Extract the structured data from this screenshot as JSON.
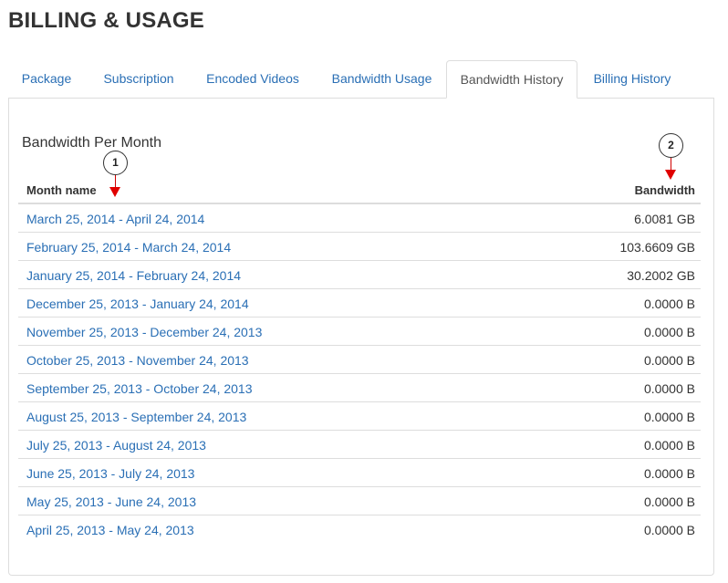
{
  "page": {
    "title": "BILLING & USAGE"
  },
  "tabs": [
    {
      "label": "Package"
    },
    {
      "label": "Subscription"
    },
    {
      "label": "Encoded Videos"
    },
    {
      "label": "Bandwidth Usage"
    },
    {
      "label": "Bandwidth History",
      "active": true
    },
    {
      "label": "Billing History"
    }
  ],
  "section": {
    "title": "Bandwidth Per Month"
  },
  "table": {
    "headers": {
      "month": "Month name",
      "bandwidth": "Bandwidth"
    },
    "rows": [
      {
        "month": "March 25, 2014 - April 24, 2014",
        "bandwidth": "6.0081 GB"
      },
      {
        "month": "February 25, 2014 - March 24, 2014",
        "bandwidth": "103.6609 GB"
      },
      {
        "month": "January 25, 2014 - February 24, 2014",
        "bandwidth": "30.2002 GB"
      },
      {
        "month": "December 25, 2013 - January 24, 2014",
        "bandwidth": "0.0000 B"
      },
      {
        "month": "November 25, 2013 - December 24, 2013",
        "bandwidth": "0.0000 B"
      },
      {
        "month": "October 25, 2013 - November 24, 2013",
        "bandwidth": "0.0000 B"
      },
      {
        "month": "September 25, 2013 - October 24, 2013",
        "bandwidth": "0.0000 B"
      },
      {
        "month": "August 25, 2013 - September 24, 2013",
        "bandwidth": "0.0000 B"
      },
      {
        "month": "July 25, 2013 - August 24, 2013",
        "bandwidth": "0.0000 B"
      },
      {
        "month": "June 25, 2013 - July 24, 2013",
        "bandwidth": "0.0000 B"
      },
      {
        "month": "May 25, 2013 - June 24, 2013",
        "bandwidth": "0.0000 B"
      },
      {
        "month": "April 25, 2013 - May 24, 2013",
        "bandwidth": "0.0000 B"
      }
    ]
  },
  "annotations": [
    {
      "number": "1"
    },
    {
      "number": "2"
    }
  ]
}
